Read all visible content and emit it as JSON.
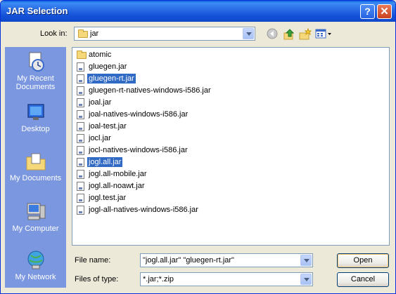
{
  "window": {
    "title": "JAR Selection",
    "help_label": "?",
    "close_label": "✕"
  },
  "lookin": {
    "label": "Look in:",
    "value": "jar"
  },
  "toolbar": {
    "back_icon": "back-icon",
    "up_icon": "up-folder-icon",
    "new_folder_icon": "new-folder-icon",
    "views_icon": "views-menu-icon"
  },
  "places": [
    {
      "label": "My Recent Documents",
      "icon": "recent-documents-icon"
    },
    {
      "label": "Desktop",
      "icon": "desktop-icon"
    },
    {
      "label": "My Documents",
      "icon": "my-documents-icon"
    },
    {
      "label": "My Computer",
      "icon": "my-computer-icon"
    },
    {
      "label": "My Network",
      "icon": "my-network-icon"
    }
  ],
  "files": [
    {
      "name": "atomic",
      "type": "folder",
      "selected": false
    },
    {
      "name": "gluegen.jar",
      "type": "file",
      "selected": false
    },
    {
      "name": "gluegen-rt.jar",
      "type": "file",
      "selected": true
    },
    {
      "name": "gluegen-rt-natives-windows-i586.jar",
      "type": "file",
      "selected": false
    },
    {
      "name": "joal.jar",
      "type": "file",
      "selected": false
    },
    {
      "name": "joal-natives-windows-i586.jar",
      "type": "file",
      "selected": false
    },
    {
      "name": "joal-test.jar",
      "type": "file",
      "selected": false
    },
    {
      "name": "jocl.jar",
      "type": "file",
      "selected": false
    },
    {
      "name": "jocl-natives-windows-i586.jar",
      "type": "file",
      "selected": false
    },
    {
      "name": "jogl.all.jar",
      "type": "file",
      "selected": true
    },
    {
      "name": "jogl.all-mobile.jar",
      "type": "file",
      "selected": false
    },
    {
      "name": "jogl.all-noawt.jar",
      "type": "file",
      "selected": false
    },
    {
      "name": "jogl.test.jar",
      "type": "file",
      "selected": false
    },
    {
      "name": "jogl-all-natives-windows-i586.jar",
      "type": "file",
      "selected": false
    }
  ],
  "filename": {
    "label": "File name:",
    "value": "\"jogl.all.jar\" \"gluegen-rt.jar\""
  },
  "filetype": {
    "label": "Files of type:",
    "value": "*.jar;*.zip"
  },
  "buttons": {
    "open": "Open",
    "cancel": "Cancel"
  },
  "colors": {
    "titlebar": "#1552d8",
    "places_bg": "#7b97e0",
    "selection": "#316ac5"
  }
}
